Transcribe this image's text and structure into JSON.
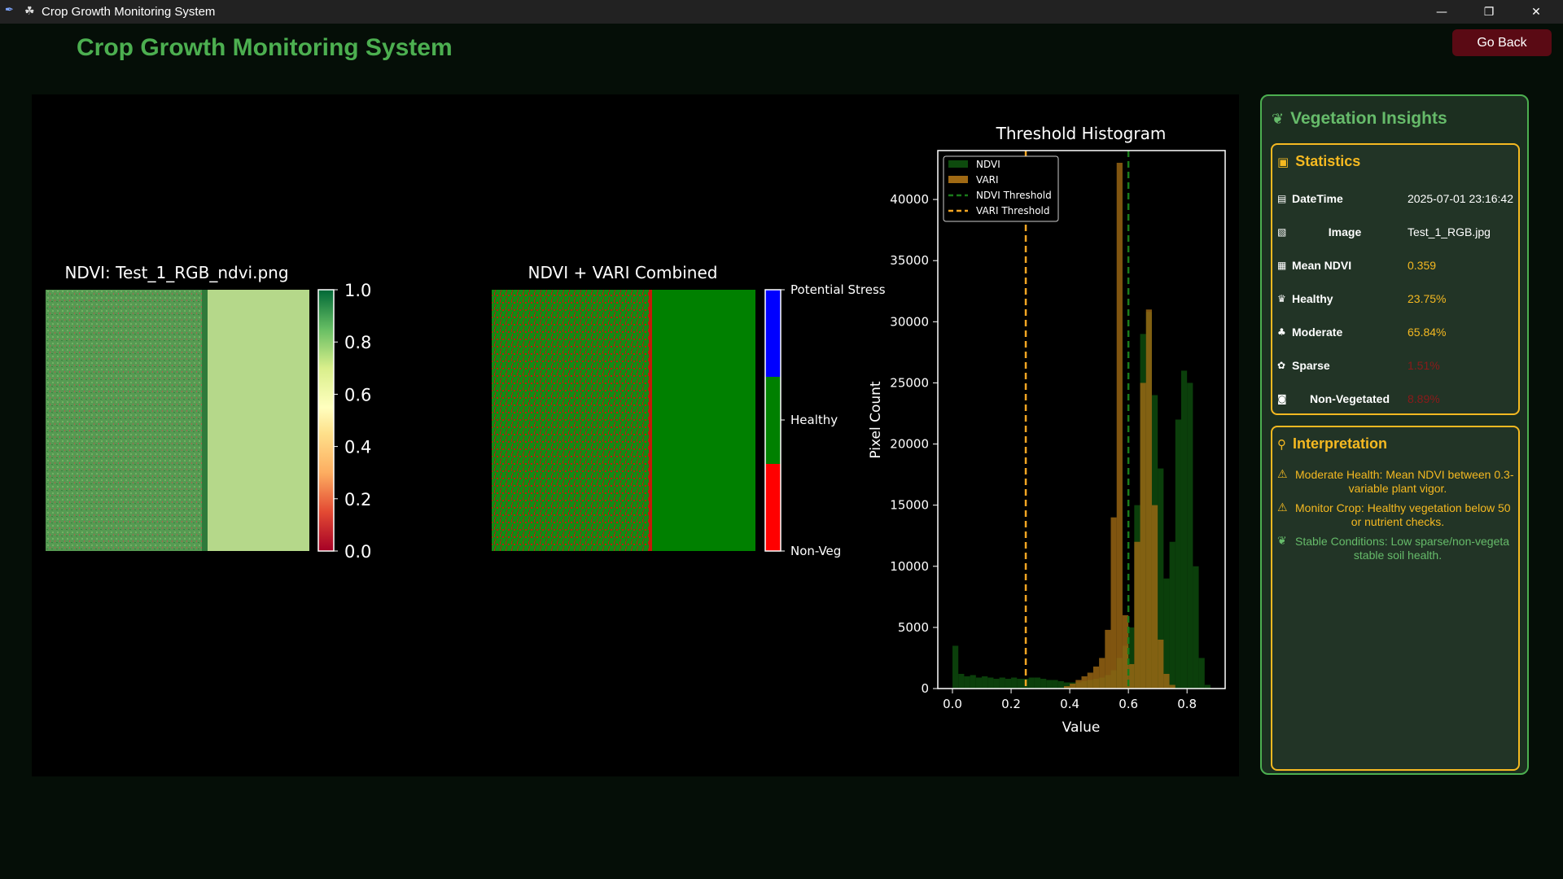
{
  "window": {
    "title": "Crop Growth Monitoring System",
    "minimize_glyph": "—",
    "restore_glyph": "❐",
    "close_glyph": "✕"
  },
  "header": {
    "title": "Crop Growth Monitoring System",
    "go_back_label": "Go Back"
  },
  "charts": {
    "ndvi_map": {
      "title": "NDVI: Test_1_RGB_ndvi.png",
      "colorbar_ticks": [
        "0.0",
        "0.2",
        "0.4",
        "0.6",
        "0.8",
        "1.0"
      ]
    },
    "combined_map": {
      "title": "NDVI + VARI Combined",
      "class_labels": [
        "Potential Stress",
        "Healthy",
        "Non-Veg"
      ],
      "class_colors": [
        "#0000ff",
        "#008000",
        "#ff0000"
      ]
    }
  },
  "chart_data": {
    "type": "bar",
    "title": "Threshold Histogram",
    "xlabel": "Value",
    "ylabel": "Pixel Count",
    "xlim": [
      -0.05,
      0.93
    ],
    "ylim": [
      0,
      44000
    ],
    "x_ticks": [
      "0.0",
      "0.2",
      "0.4",
      "0.6",
      "0.8"
    ],
    "y_ticks": [
      "0",
      "5000",
      "10000",
      "15000",
      "20000",
      "25000",
      "30000",
      "35000",
      "40000"
    ],
    "legend_position": "top-left",
    "bin_width": 0.02,
    "series": [
      {
        "name": "NDVI",
        "color": "#0d4a0d",
        "x": [
          0.0,
          0.02,
          0.04,
          0.06,
          0.08,
          0.1,
          0.12,
          0.14,
          0.16,
          0.18,
          0.2,
          0.22,
          0.24,
          0.26,
          0.28,
          0.3,
          0.32,
          0.34,
          0.36,
          0.38,
          0.4,
          0.42,
          0.44,
          0.46,
          0.48,
          0.5,
          0.52,
          0.54,
          0.56,
          0.58,
          0.6,
          0.62,
          0.64,
          0.66,
          0.68,
          0.7,
          0.72,
          0.74,
          0.76,
          0.78,
          0.8,
          0.82,
          0.84,
          0.86,
          0.88
        ],
        "values": [
          3500,
          1200,
          1000,
          1100,
          900,
          1000,
          900,
          800,
          900,
          800,
          900,
          800,
          800,
          900,
          900,
          800,
          700,
          700,
          600,
          500,
          500,
          500,
          600,
          700,
          800,
          900,
          1100,
          1500,
          2500,
          3500,
          5000,
          15000,
          29000,
          30800,
          24000,
          18000,
          9000,
          12000,
          22000,
          26000,
          25000,
          10000,
          2500,
          300,
          0
        ]
      },
      {
        "name": "VARI",
        "color": "#a06a14",
        "x": [
          0.38,
          0.4,
          0.42,
          0.44,
          0.46,
          0.48,
          0.5,
          0.52,
          0.54,
          0.56,
          0.58,
          0.6,
          0.62,
          0.64,
          0.66,
          0.68,
          0.7,
          0.72,
          0.74
        ],
        "values": [
          200,
          400,
          700,
          1000,
          1300,
          1800,
          2500,
          4800,
          14000,
          43000,
          6000,
          2000,
          12000,
          25000,
          31000,
          15000,
          4000,
          1200,
          300
        ]
      }
    ],
    "thresholds": [
      {
        "name": "NDVI Threshold",
        "value": 0.6,
        "color": "#1a7a1a"
      },
      {
        "name": "VARI Threshold",
        "value": 0.25,
        "color": "#f5a623"
      }
    ]
  },
  "insights": {
    "title": "Vegetation Insights",
    "title_icon": "leaf-icon",
    "statistics": {
      "title": "Statistics",
      "title_icon": "package-icon",
      "rows": [
        {
          "label": "DateTime",
          "value": "2025-07-01 23:16:42",
          "color": "#ffffff",
          "icon": "calendar-icon"
        },
        {
          "label": "Image",
          "value": "Test_1_RGB.jpg",
          "color": "#ffffff",
          "icon": "image-icon"
        },
        {
          "label": "Mean NDVI",
          "value": "0.359",
          "color": "#f5b921",
          "icon": "chart-icon"
        },
        {
          "label": "Healthy",
          "value": "23.75%",
          "color": "#f5b921",
          "icon": "trophy-icon"
        },
        {
          "label": "Moderate",
          "value": "65.84%",
          "color": "#f5b921",
          "icon": "sprout-icon"
        },
        {
          "label": "Sparse",
          "value": "1.51%",
          "color": "#8b1a1a",
          "icon": "wilt-icon"
        },
        {
          "label": "Non-Vegetated",
          "value": "8.89%",
          "color": "#8b1a1a",
          "icon": "soil-icon"
        }
      ]
    },
    "interpretation": {
      "title": "Interpretation",
      "title_icon": "magnifier-icon",
      "items": [
        {
          "line1": "Moderate Health: Mean NDVI between 0.3-",
          "line2": "variable plant vigor.",
          "color": "#f5b921",
          "icon": "warning-icon"
        },
        {
          "line1": "Monitor Crop: Healthy vegetation below 50",
          "line2": "or nutrient checks.",
          "color": "#f5b921",
          "icon": "warning-icon"
        },
        {
          "line1": "Stable Conditions: Low sparse/non-vegeta",
          "line2": "stable soil health.",
          "color": "#66bb6a",
          "icon": "leaf-icon"
        }
      ]
    }
  }
}
